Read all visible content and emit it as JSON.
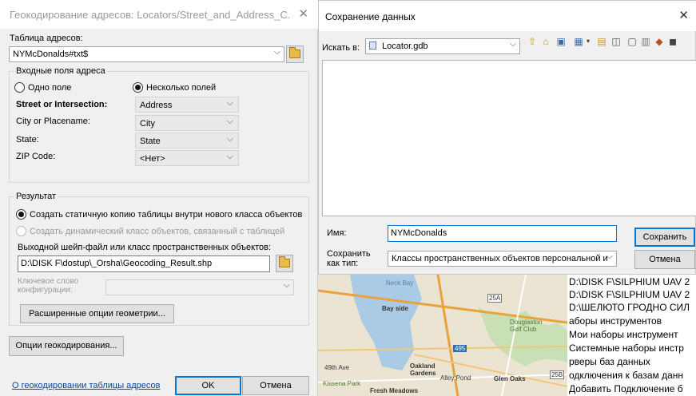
{
  "geocode_dialog": {
    "title": "Геокодирование адресов: Locators/Street_and_Address_C...",
    "table_label": "Таблица адресов:",
    "table_value": "NYMcDonalds#txt$",
    "input_fields": {
      "group_label": "Входные поля адреса",
      "single_field": "Одно поле",
      "multiple_fields": "Несколько полей",
      "rows": [
        {
          "label": "Street or Intersection:",
          "value": "Address"
        },
        {
          "label": "City or Placename:",
          "value": "City"
        },
        {
          "label": "State:",
          "value": "State"
        },
        {
          "label": "ZIP Code:",
          "value": "<Нет>"
        }
      ]
    },
    "result": {
      "group_label": "Результат",
      "static_copy": "Создать статичную копию  таблицы внутри нового класса объектов",
      "dynamic_class": "Создать динамический класс объектов, связанный с таблицей",
      "output_label": "Выходной шейп-файл или класс пространственных объектов:",
      "output_value": "D:\\DISK F\\dostup\\_Orsha\\Geocoding_Result.shp",
      "keyword_label": "Ключевое слово конфигурации:",
      "advanced_button": "Расширенные опции геометрии..."
    },
    "geocoding_options_button": "Опции геокодирования...",
    "about_link": "О геокодировании таблицы адресов",
    "ok_button": "OK",
    "cancel_button": "Отмена"
  },
  "save_dialog": {
    "title": "Сохранение данных",
    "look_in_label": "Искать в:",
    "look_in_value": "Locator.gdb",
    "name_label": "Имя:",
    "name_value": "NYMcDonalds",
    "save_as_type_label": "Сохранить как тип:",
    "save_as_type_value": "Классы пространственных объектов персональной и",
    "save_button": "Сохранить",
    "cancel_button": "Отмена"
  },
  "map": {
    "labels": [
      "Neck Bay",
      "Bay side",
      "Oakland Gardens",
      "Glen Oaks",
      "Fresh Meadows",
      "Alley Pond",
      "Kissena Park",
      "Douglaston Golf Club",
      "49th Ave",
      "25A",
      "495",
      "25B"
    ]
  },
  "catalog": {
    "items": [
      "D:\\DISK F\\SILPHIUM UAV 2",
      "D:\\DISK F\\SILPHIUM UAV 2",
      "D:\\ШЕЛЮТО ГРОДНО СИЛ",
      "аборы инструментов",
      "Мои наборы инструмент",
      "Системные наборы инстр",
      "рверы баз данных",
      "одключения к базам данн",
      "Добавить Подключение б"
    ]
  },
  "colors": {
    "link": "#0645ad",
    "accent": "#0078d7",
    "map_water": "#a9cbe6",
    "map_land": "#ece4d3"
  }
}
